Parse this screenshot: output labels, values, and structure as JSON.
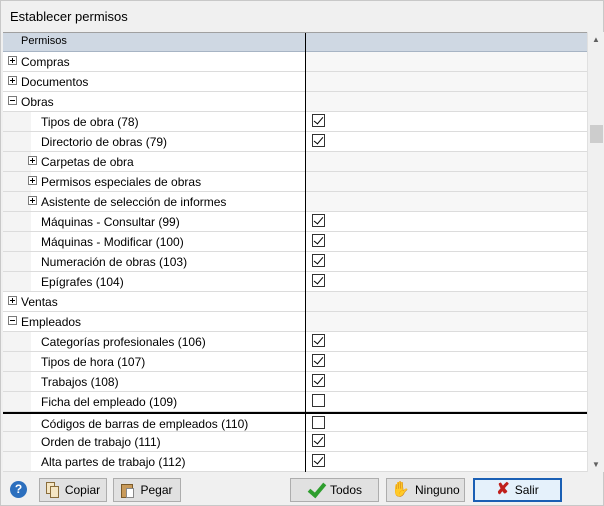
{
  "window": {
    "title": "Establecer permisos"
  },
  "grid": {
    "header": {
      "col1": "Permisos",
      "col2": ""
    },
    "rows": [
      {
        "label": "Compras",
        "level": 0,
        "expander": "plus",
        "checkbox": null
      },
      {
        "label": "Documentos",
        "level": 0,
        "expander": "plus",
        "checkbox": null
      },
      {
        "label": "Obras",
        "level": 0,
        "expander": "minus",
        "checkbox": null
      },
      {
        "label": "Tipos de obra (78)",
        "level": 1,
        "expander": null,
        "checkbox": true
      },
      {
        "label": "Directorio de obras (79)",
        "level": 1,
        "expander": null,
        "checkbox": true
      },
      {
        "label": "Carpetas de obra",
        "level": 1,
        "expander": "plus",
        "checkbox": null
      },
      {
        "label": "Permisos especiales de obras",
        "level": 1,
        "expander": "plus",
        "checkbox": null
      },
      {
        "label": "Asistente de selección de informes",
        "level": 1,
        "expander": "plus",
        "checkbox": null
      },
      {
        "label": "Máquinas - Consultar (99)",
        "level": 1,
        "expander": null,
        "checkbox": true
      },
      {
        "label": "Máquinas - Modificar (100)",
        "level": 1,
        "expander": null,
        "checkbox": true
      },
      {
        "label": "Numeración de obras (103)",
        "level": 1,
        "expander": null,
        "checkbox": true
      },
      {
        "label": "Epígrafes (104)",
        "level": 1,
        "expander": null,
        "checkbox": true
      },
      {
        "label": "Ventas",
        "level": 0,
        "expander": "plus",
        "checkbox": null
      },
      {
        "label": "Empleados",
        "level": 0,
        "expander": "minus",
        "checkbox": null
      },
      {
        "label": "Categorías profesionales (106)",
        "level": 1,
        "expander": null,
        "checkbox": true
      },
      {
        "label": "Tipos de hora (107)",
        "level": 1,
        "expander": null,
        "checkbox": true
      },
      {
        "label": "Trabajos (108)",
        "level": 1,
        "expander": null,
        "checkbox": true
      },
      {
        "label": "Ficha del empleado (109)",
        "level": 1,
        "expander": null,
        "checkbox": false
      },
      {
        "label": "Códigos de barras de empleados (110)",
        "level": 1,
        "expander": null,
        "checkbox": false,
        "focused": true
      },
      {
        "label": "Orden de trabajo (111)",
        "level": 1,
        "expander": null,
        "checkbox": true
      },
      {
        "label": "Alta partes de trabajo (112)",
        "level": 1,
        "expander": null,
        "checkbox": true
      }
    ]
  },
  "footer": {
    "help_icon": "?",
    "copy_label": "Copiar",
    "paste_label": "Pegar",
    "all_label": "Todos",
    "none_label": "Ninguno",
    "exit_label": "Salir"
  },
  "colors": {
    "header_bg": "#cfd8e3",
    "accent": "#1a5fb4",
    "check_green": "#2e9e2e",
    "exit_red": "#c0201c"
  }
}
